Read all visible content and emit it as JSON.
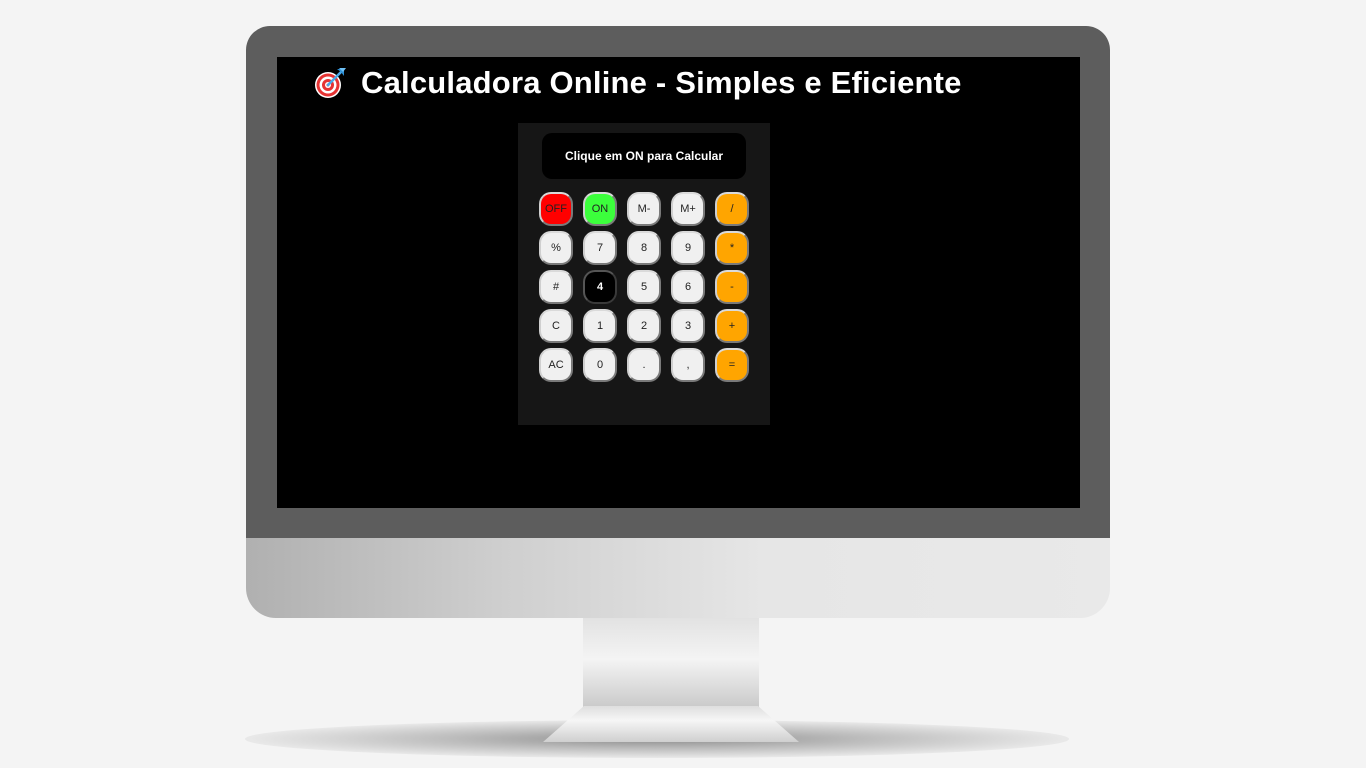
{
  "page": {
    "title": "Calculadora Online - Simples e Eficiente",
    "title_icon": "target-icon"
  },
  "calculator": {
    "display_text": "Clique em ON para Calcular",
    "keys": [
      {
        "label": "OFF",
        "name": "off-button",
        "style": "off"
      },
      {
        "label": "ON",
        "name": "on-button",
        "style": "on"
      },
      {
        "label": "M-",
        "name": "memory-minus-button",
        "style": ""
      },
      {
        "label": "M+",
        "name": "memory-plus-button",
        "style": ""
      },
      {
        "label": "/",
        "name": "divide-button",
        "style": "op"
      },
      {
        "label": "%",
        "name": "percent-button",
        "style": ""
      },
      {
        "label": "7",
        "name": "digit-7-button",
        "style": ""
      },
      {
        "label": "8",
        "name": "digit-8-button",
        "style": ""
      },
      {
        "label": "9",
        "name": "digit-9-button",
        "style": ""
      },
      {
        "label": "*",
        "name": "multiply-button",
        "style": "op"
      },
      {
        "label": "#",
        "name": "hash-button",
        "style": ""
      },
      {
        "label": "4",
        "name": "digit-4-button",
        "style": "dark"
      },
      {
        "label": "5",
        "name": "digit-5-button",
        "style": ""
      },
      {
        "label": "6",
        "name": "digit-6-button",
        "style": ""
      },
      {
        "label": "-",
        "name": "subtract-button",
        "style": "op"
      },
      {
        "label": "C",
        "name": "clear-button",
        "style": ""
      },
      {
        "label": "1",
        "name": "digit-1-button",
        "style": ""
      },
      {
        "label": "2",
        "name": "digit-2-button",
        "style": ""
      },
      {
        "label": "3",
        "name": "digit-3-button",
        "style": ""
      },
      {
        "label": "+",
        "name": "add-button",
        "style": "op"
      },
      {
        "label": "AC",
        "name": "all-clear-button",
        "style": ""
      },
      {
        "label": "0",
        "name": "digit-0-button",
        "style": ""
      },
      {
        "label": ".",
        "name": "decimal-point-button",
        "style": ""
      },
      {
        "label": ",",
        "name": "comma-button",
        "style": ""
      },
      {
        "label": "=",
        "name": "equals-button",
        "style": "op"
      }
    ]
  },
  "colors": {
    "screen_background": "#000000",
    "calculator_body": "#161616",
    "off_key": "#ff0000",
    "on_key": "#3cff3c",
    "operator_key": "#ffa500",
    "number_key": "#f0f0f0",
    "monitor_bezel": "#5d5d5d"
  }
}
